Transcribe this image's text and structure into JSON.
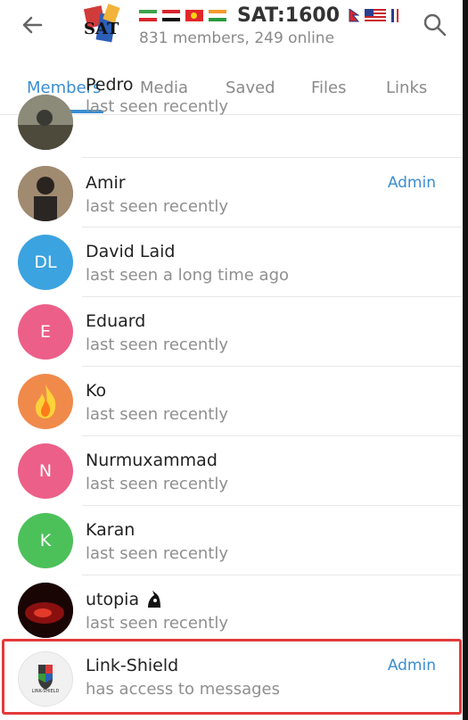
{
  "header": {
    "title": "SAT:1600",
    "subtitle": "831 members, 249 online",
    "back_icon": "arrow-left-icon",
    "search_icon": "search-icon"
  },
  "tabs": [
    {
      "label": "Members",
      "active": true
    },
    {
      "label": "Media",
      "active": false
    },
    {
      "label": "Saved",
      "active": false
    },
    {
      "label": "Files",
      "active": false
    },
    {
      "label": "Links",
      "active": false
    }
  ],
  "members": [
    {
      "name": "Pedro",
      "status": "last seen recently",
      "role": "",
      "initials": "",
      "color": "#6b6b5e"
    },
    {
      "name": "Amir",
      "status": "last seen recently",
      "role": "Admin",
      "initials": "",
      "color": "#7a5f4a"
    },
    {
      "name": "David Laid",
      "status": "last seen a long time ago",
      "role": "",
      "initials": "DL",
      "color": "#3ba3e0"
    },
    {
      "name": "Eduard",
      "status": "last seen recently",
      "role": "",
      "initials": "E",
      "color": "#ec5f88"
    },
    {
      "name": "Ko",
      "status": "last seen recently",
      "role": "",
      "initials": "",
      "color": "#f08a4b"
    },
    {
      "name": "Nurmuxammad",
      "status": "last seen recently",
      "role": "",
      "initials": "N",
      "color": "#ec5f88"
    },
    {
      "name": "Karan",
      "status": "last seen recently",
      "role": "",
      "initials": "K",
      "color": "#4cc15a"
    },
    {
      "name": "utopia",
      "status": "last seen recently",
      "role": "",
      "initials": "",
      "color": "#3a0a0a"
    },
    {
      "name": "Link-Shield",
      "status": "has access to messages",
      "role": "Admin",
      "initials": "",
      "color": "#f1f1f1",
      "logo_text": "LINK-SHIELD"
    }
  ]
}
